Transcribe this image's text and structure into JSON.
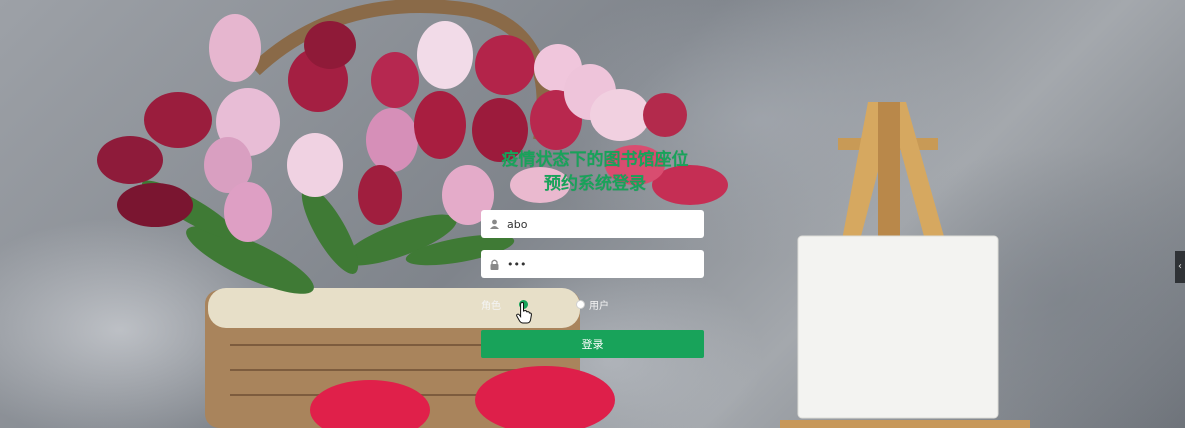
{
  "login": {
    "title_line1": "疫情状态下的图书馆座位",
    "title_line2": "预约系统登录",
    "username_value": "abo",
    "password_value": "•••",
    "role_label": "角色",
    "role_options": [
      "",
      "用户"
    ],
    "selected_role_index": 0,
    "submit_label": "登录"
  },
  "edge_tab_glyph": "‹",
  "icons": {
    "username": "user-icon",
    "password": "lock-icon",
    "cursor": "hand-pointer-icon"
  },
  "colors": {
    "accent": "#18a35a",
    "title": "#18a35a"
  }
}
